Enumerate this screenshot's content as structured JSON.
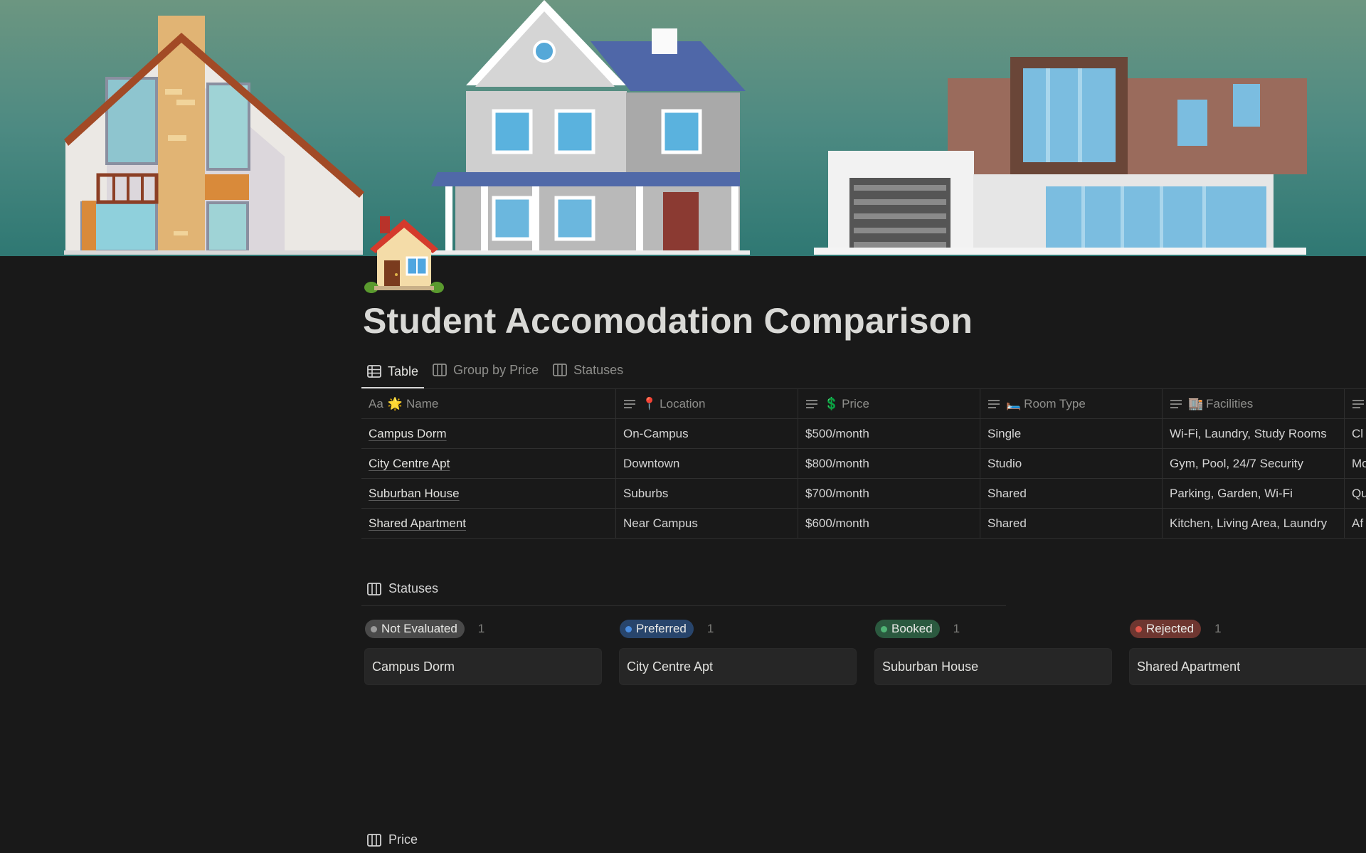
{
  "page": {
    "title": "Student Accomodation Comparison"
  },
  "tabs": [
    {
      "label": "Table",
      "icon": "table-icon",
      "active": true
    },
    {
      "label": "Group by Price",
      "icon": "board-icon",
      "active": false
    },
    {
      "label": "Statuses",
      "icon": "board-icon",
      "active": false
    }
  ],
  "table": {
    "headers": [
      {
        "prefix": "Aa",
        "emoji": "🌟",
        "label": "Name"
      },
      {
        "emoji": "📍",
        "label": "Location"
      },
      {
        "emoji": "💲",
        "label": "Price"
      },
      {
        "emoji": "🛏️",
        "label": "Room Type"
      },
      {
        "emoji": "🏬",
        "label": "Facilities"
      }
    ],
    "rows": [
      {
        "name": "Campus Dorm",
        "location": "On-Campus",
        "price": "$500/month",
        "room_type": "Single",
        "facilities": "Wi-Fi, Laundry, Study Rooms",
        "extra": "Cl"
      },
      {
        "name": "City Centre Apt",
        "location": "Downtown",
        "price": "$800/month",
        "room_type": "Studio",
        "facilities": "Gym, Pool, 24/7 Security",
        "extra": "Mo"
      },
      {
        "name": "Suburban House",
        "location": "Suburbs",
        "price": "$700/month",
        "room_type": "Shared",
        "facilities": "Parking, Garden, Wi-Fi",
        "extra": "Qu"
      },
      {
        "name": "Shared Apartment",
        "location": "Near Campus",
        "price": "$600/month",
        "room_type": "Shared",
        "facilities": "Kitchen, Living Area, Laundry",
        "extra": "Af"
      }
    ]
  },
  "statuses_section": {
    "title": "Statuses",
    "columns": [
      {
        "label": "Not Evaluated",
        "count": "1",
        "card": "Campus Dorm",
        "pill_color": "#4a4a4a",
        "dot_color": "#9b9b9b"
      },
      {
        "label": "Preferred",
        "count": "1",
        "card": "City Centre Apt",
        "pill_color": "#28456c",
        "dot_color": "#4a8de0"
      },
      {
        "label": "Booked",
        "count": "1",
        "card": "Suburban House",
        "pill_color": "#2b593f",
        "dot_color": "#4fb274"
      },
      {
        "label": "Rejected",
        "count": "1",
        "card": "Shared Apartment",
        "pill_color": "#6e3630",
        "dot_color": "#e0554a"
      }
    ]
  },
  "price_section": {
    "title": "Price"
  },
  "colors": {
    "background": "#191919",
    "cover_top": "#6c9681",
    "cover_bottom": "#2f7873"
  }
}
